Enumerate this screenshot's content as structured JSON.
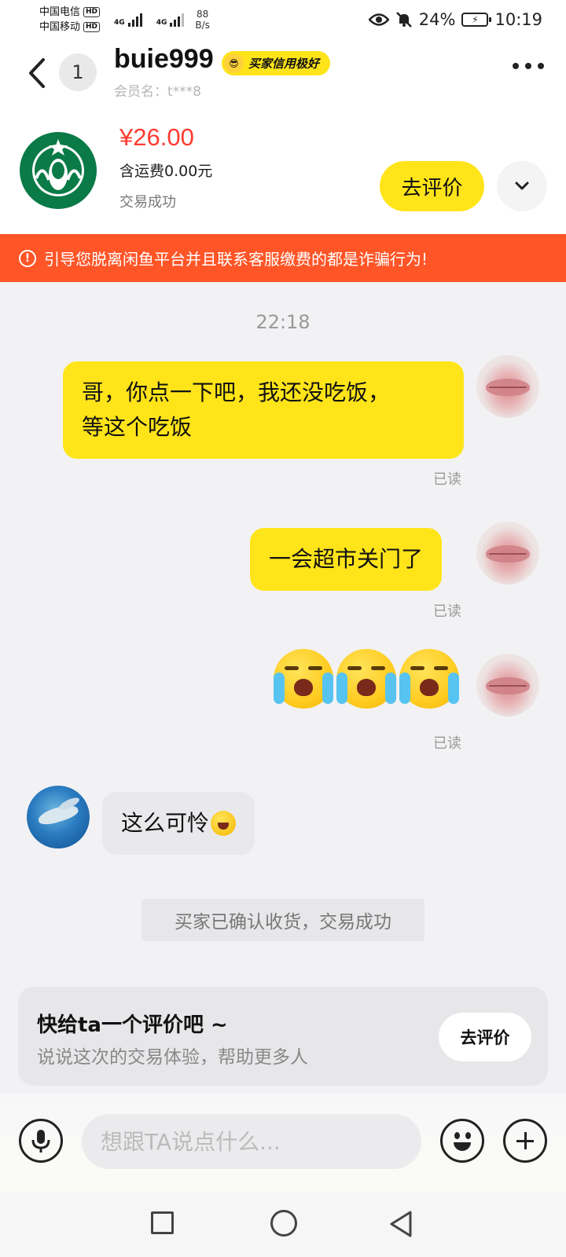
{
  "status_bar": {
    "carrier1": "中国电信",
    "carrier2": "中国移动",
    "hd": "HD",
    "network": "4G",
    "net_speed_value": "88",
    "net_speed_unit": "B/s",
    "battery": "24%",
    "time": "10:19"
  },
  "header": {
    "unread_count": "1",
    "nickname": "buie999",
    "credit_badge": "买家信用极好",
    "member_label": "会员名：",
    "member_id": "t***8"
  },
  "product": {
    "price": "¥26.00",
    "shipping": "含运费0.00元",
    "status": "交易成功",
    "rate_button": "去评价"
  },
  "warning": {
    "text": "引导您脱离闲鱼平台并且联系客服缴费的都是诈骗行为!"
  },
  "chat": {
    "timestamp": "22:18",
    "messages": [
      {
        "from": "self",
        "line1": "哥，你点一下吧，我还没吃饭，",
        "line2": "等这个吃饭",
        "read": "已读"
      },
      {
        "from": "self",
        "text": "一会超市关门了",
        "read": "已读"
      },
      {
        "from": "self",
        "emoji": "crying-face x3",
        "read": "已读"
      },
      {
        "from": "other",
        "text": "这么可怜"
      }
    ],
    "system_message": "买家已确认收货，交易成功"
  },
  "rate_prompt": {
    "title": "快给ta一个评价吧 ~",
    "subtitle": "说说这次的交易体验，帮助更多人",
    "button": "去评价"
  },
  "input_bar": {
    "placeholder": "想跟TA说点什么..."
  },
  "colors": {
    "accent_yellow": "#ffe41a",
    "price_red": "#ff3b30",
    "warning_orange": "#ff5527"
  }
}
